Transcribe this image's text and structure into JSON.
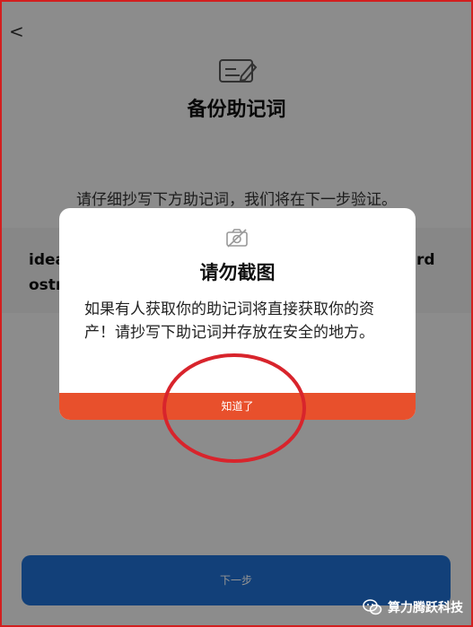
{
  "header": {
    "back_glyph": "<",
    "icon": "edit-card-icon",
    "title": "备份助记词"
  },
  "instruction": "请仔细抄写下方助记词，我们将在下一步验证。",
  "phrase_visible_fragments": [
    "idea",
    "ostr",
    "rd"
  ],
  "next_button": {
    "label": "下一步",
    "color": "#1f6fd0"
  },
  "modal": {
    "icon": "no-camera-icon",
    "title": "请勿截图",
    "body": "如果有人获取你的助记词将直接获取你的资产！请抄写下助记词并存放在安全的地方。",
    "confirm_label": "知道了",
    "confirm_color": "#e8502c"
  },
  "annotation": {
    "color": "#d8242c"
  },
  "watermark": {
    "icon": "wechat-icon",
    "text": "算力腾跃科技"
  }
}
